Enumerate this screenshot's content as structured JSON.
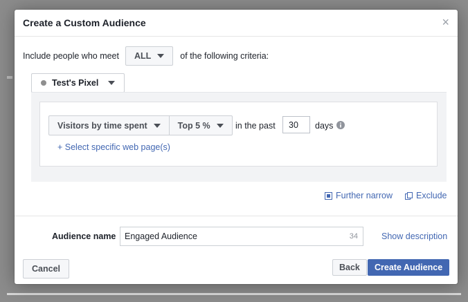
{
  "dialog": {
    "title": "Create a Custom Audience",
    "close_glyph": "×"
  },
  "criteria": {
    "prefix": "Include people who meet",
    "match_value": "ALL",
    "suffix": "of the following criteria:"
  },
  "source": {
    "pixel_label": "Test's Pixel"
  },
  "rule": {
    "event_label": "Visitors by time spent",
    "percentile_label": "Top 5 %",
    "in_past_text": "in the past",
    "days_value": "30",
    "days_text": "days",
    "select_pages_link": "+ Select specific web page(s)"
  },
  "actions": {
    "further_narrow": "Further narrow",
    "exclude": "Exclude"
  },
  "audience": {
    "label": "Audience name",
    "value": "Engaged Audience",
    "char_count": "34",
    "show_description": "Show description"
  },
  "footer": {
    "cancel": "Cancel",
    "back": "Back",
    "create": "Create Audience"
  },
  "colors": {
    "link": "#4267b2",
    "primary_button": "#4267b2",
    "overlay": "#8c8c8c"
  },
  "icons": {
    "close": "close-icon",
    "dropdown": "caret-down-icon",
    "pixel_status": "status-dot-icon",
    "info": "info-icon",
    "narrow": "narrow-icon",
    "exclude": "exclude-icon"
  }
}
